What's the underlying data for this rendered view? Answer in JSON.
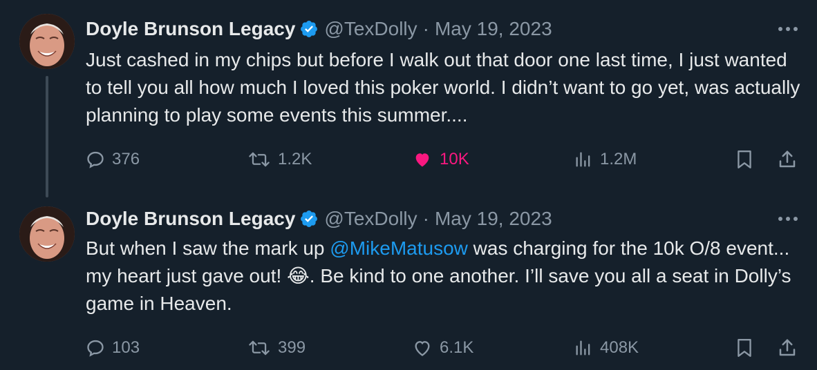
{
  "tweets": [
    {
      "author": {
        "display_name": "Doyle Brunson Legacy",
        "handle": "@TexDolly",
        "verified": true,
        "avatar_icon": "avatar-photo"
      },
      "separator": "·",
      "date": "May 19, 2023",
      "text": "Just cashed in my chips but before I walk out that door one last time, I just wanted to tell you all how much I loved this poker world. I didn’t want to go yet, was actually planning to play some events this summer....",
      "stats": {
        "replies": "376",
        "reposts": "1.2K",
        "likes": "10K",
        "views": "1.2M"
      },
      "liked": true
    },
    {
      "author": {
        "display_name": "Doyle Brunson Legacy",
        "handle": "@TexDolly",
        "verified": true,
        "avatar_icon": "avatar-photo"
      },
      "separator": "·",
      "date": "May 19, 2023",
      "text_parts": {
        "before": "But when I saw the mark up ",
        "mention": "@MikeMatusow",
        "after_mention": " was charging for the 10k O/8 event... my heart just gave out! ",
        "emoji": "😂",
        "end": ". Be kind to one another. I’ll save you all a seat in Dolly’s game in Heaven."
      },
      "stats": {
        "replies": "103",
        "reposts": "399",
        "likes": "6.1K",
        "views": "408K"
      },
      "liked": false
    }
  ],
  "colors": {
    "background": "#15202b",
    "text": "#e7e9ea",
    "muted": "#8b98a5",
    "link": "#1d9bf0",
    "like_active": "#f91880",
    "verified_badge": "#1d9bf0"
  }
}
